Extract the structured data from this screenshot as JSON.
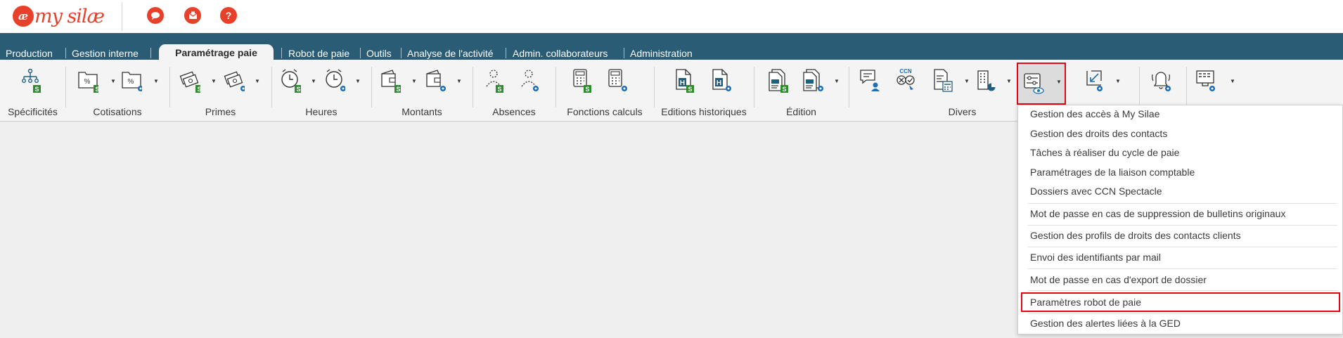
{
  "app": {
    "logo_text": "my silæ",
    "logo_mark": "æ"
  },
  "top_icons": [
    {
      "name": "chat-icon",
      "glyph": "✉"
    },
    {
      "name": "mail-icon",
      "glyph": "✉"
    },
    {
      "name": "help-icon",
      "glyph": "?"
    }
  ],
  "tabs": [
    {
      "label": "Production"
    },
    {
      "label": "Gestion interne"
    },
    {
      "label": "Paramétrage paie"
    },
    {
      "label": "Robot de paie"
    },
    {
      "label": "Outils"
    },
    {
      "label": "Analyse de l'activité"
    },
    {
      "label": "Admin. collaborateurs"
    },
    {
      "label": "Administration"
    }
  ],
  "ribbon_groups": [
    {
      "label": "Spécificités"
    },
    {
      "label": "Cotisations"
    },
    {
      "label": "Primes"
    },
    {
      "label": "Heures"
    },
    {
      "label": "Montants"
    },
    {
      "label": "Absences"
    },
    {
      "label": "Fonctions calculs"
    },
    {
      "label": "Editions historiques"
    },
    {
      "label": "Édition"
    },
    {
      "label": "Divers"
    }
  ],
  "ribbon_badges": {
    "s": "S",
    "h": "H",
    "ccn": "CCN"
  },
  "dropdown_menu": {
    "items": [
      {
        "label": "Gestion des accès à My Silae"
      },
      {
        "label": "Gestion des droits des contacts"
      },
      {
        "label": "Tâches à réaliser du cycle de paie"
      },
      {
        "label": "Paramétrages de la liaison comptable"
      },
      {
        "label": "Dossiers avec CCN Spectacle"
      },
      {
        "label": "Mot de passe en cas de suppression de bulletins originaux"
      },
      {
        "label": "Gestion des profils de droits des contacts clients"
      },
      {
        "label": "Envoi des identifiants par mail"
      },
      {
        "label": "Mot de passe en cas d'export de dossier"
      },
      {
        "label": "Paramètres robot de paie"
      },
      {
        "label": "Gestion des alertes liées à la GED"
      }
    ]
  },
  "colors": {
    "brand": "#e8412b",
    "nav_bg": "#2a5d75",
    "highlight": "#e30613",
    "badge_green": "#2e8b2e",
    "gear_blue": "#1c6fb5"
  }
}
